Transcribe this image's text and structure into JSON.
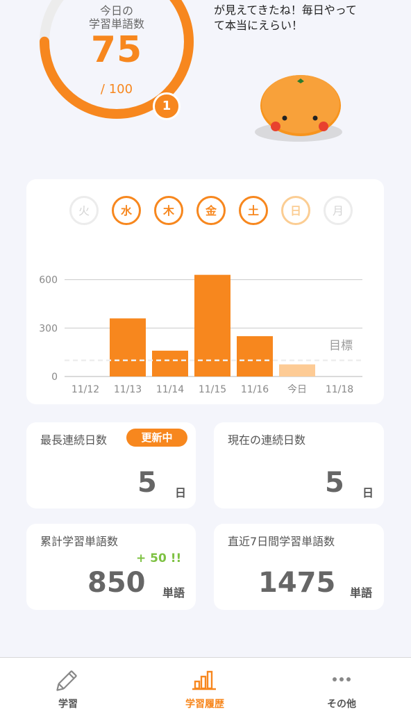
{
  "today": {
    "label": "今日の\n学習単語数",
    "label_line1": "今日の",
    "label_line2": "学習単語数",
    "value": "75",
    "total": "/ 100",
    "badge": "1",
    "progress_fraction": 0.75
  },
  "speech": {
    "line1": "が見えてきたね！毎日やって",
    "line2": "て本当にえらい！"
  },
  "week": {
    "days": [
      {
        "label": "火",
        "state": "off"
      },
      {
        "label": "水",
        "state": "done"
      },
      {
        "label": "木",
        "state": "done"
      },
      {
        "label": "金",
        "state": "done"
      },
      {
        "label": "土",
        "state": "done"
      },
      {
        "label": "日",
        "state": "today"
      },
      {
        "label": "月",
        "state": "off"
      }
    ]
  },
  "chart_data": {
    "type": "bar",
    "categories": [
      "11/12",
      "11/13",
      "11/14",
      "11/15",
      "11/16",
      "今日",
      "11/18"
    ],
    "values": [
      0,
      360,
      160,
      630,
      250,
      75,
      0
    ],
    "highlight_category": "今日",
    "y_ticks": [
      0,
      300,
      600
    ],
    "ylim": [
      0,
      650
    ],
    "goal_value": 100,
    "goal_label": "目標",
    "grid": true,
    "colors": {
      "bar": "#f7871e",
      "bar_today": "#fdcb95",
      "goal_line": "#eeeeee",
      "grid": "#c8c8c8"
    }
  },
  "stats": {
    "longest_streak": {
      "title": "最長連続日数",
      "badge": "更新中",
      "value": "5",
      "unit": "日"
    },
    "current_streak": {
      "title": "現在の連続日数",
      "value": "5",
      "unit": "日"
    },
    "total_words": {
      "title": "累計学習単語数",
      "plus": "+ 50 !!",
      "value": "850",
      "unit": "単語"
    },
    "recent_words": {
      "title": "直近7日間学習単語数",
      "value": "1475",
      "unit": "単語"
    }
  },
  "tabs": [
    {
      "label": "学習",
      "icon": "pencil-icon",
      "active": false
    },
    {
      "label": "学習履歴",
      "icon": "bar-chart-icon",
      "active": true
    },
    {
      "label": "その他",
      "icon": "more-icon",
      "active": false
    }
  ],
  "colors": {
    "accent": "#f7871e",
    "accent_light": "#fdcb95",
    "plus_green": "#7dc142",
    "background": "#f4f5fb"
  }
}
